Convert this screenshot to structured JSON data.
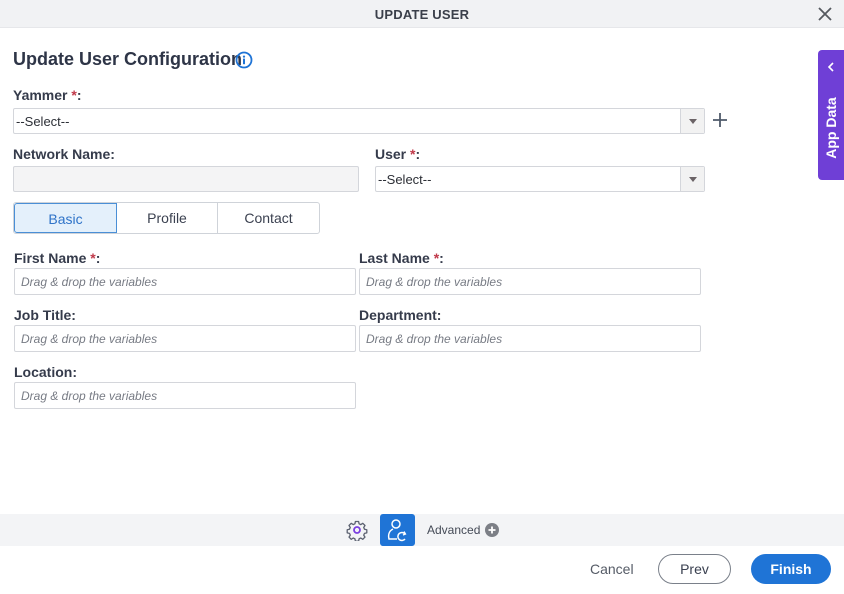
{
  "window": {
    "title": "UPDATE USER",
    "close_icon": "close-icon"
  },
  "header": {
    "title": "Update User Configuration",
    "info_icon": "info-icon"
  },
  "required_marker": "*",
  "fields": {
    "yammer": {
      "label": "Yammer",
      "colon": ":",
      "value": "--Select--"
    },
    "network_name": {
      "label": "Network Name:",
      "value": ""
    },
    "user": {
      "label": "User",
      "colon": ":",
      "value": "--Select--"
    }
  },
  "tabs": [
    {
      "label": "Basic",
      "active": true
    },
    {
      "label": "Profile",
      "active": false
    },
    {
      "label": "Contact",
      "active": false
    }
  ],
  "basic": {
    "first_name": {
      "label": "First Name",
      "colon": ":",
      "placeholder": "Drag & drop the variables"
    },
    "last_name": {
      "label": "Last Name",
      "colon": ":",
      "placeholder": "Drag & drop the variables"
    },
    "job_title": {
      "label": "Job Title:",
      "placeholder": "Drag & drop the variables"
    },
    "department": {
      "label": "Department:",
      "placeholder": "Drag & drop the variables"
    },
    "location": {
      "label": "Location:",
      "placeholder": "Drag & drop the variables"
    }
  },
  "side_panel": {
    "label": "App Data"
  },
  "toolbar": {
    "advanced_label": "Advanced"
  },
  "footer": {
    "cancel_label": "Cancel",
    "prev_label": "Prev",
    "finish_label": "Finish"
  },
  "colors": {
    "accent": "#1f74d6",
    "side_panel": "#6f3fd6",
    "required": "#c0394a"
  }
}
